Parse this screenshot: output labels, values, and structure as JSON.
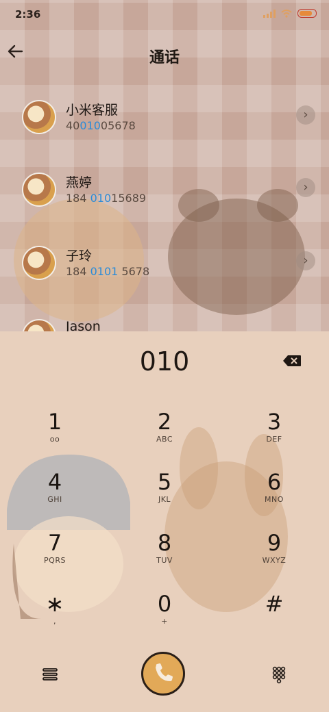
{
  "status": {
    "time": "2:36"
  },
  "header": {
    "title": "通话",
    "back_icon": "back-arrow-icon"
  },
  "contacts": [
    {
      "name": "小米客服",
      "number_pre": "40",
      "number_hl": "010",
      "number_post": "05678"
    },
    {
      "name": "燕婷",
      "number_pre": "184 ",
      "number_hl": "010",
      "number_post": "15689"
    },
    {
      "name": "子玲",
      "number_pre": "184 ",
      "number_hl": "0101",
      "number_post": " 5678"
    },
    {
      "name": "Jason",
      "number_pre": "",
      "number_hl": "",
      "number_post": ""
    }
  ],
  "dialer": {
    "display": "010",
    "keys": [
      {
        "digit": "1",
        "letters": "ᴏᴏ"
      },
      {
        "digit": "2",
        "letters": "ABC"
      },
      {
        "digit": "3",
        "letters": "DEF"
      },
      {
        "digit": "4",
        "letters": "GHI"
      },
      {
        "digit": "5",
        "letters": "JKL"
      },
      {
        "digit": "6",
        "letters": "MNO"
      },
      {
        "digit": "7",
        "letters": "PQRS"
      },
      {
        "digit": "8",
        "letters": "TUV"
      },
      {
        "digit": "9",
        "letters": "WXYZ"
      },
      {
        "digit": "∗",
        "letters": ","
      },
      {
        "digit": "0",
        "letters": "+"
      },
      {
        "digit": "#",
        "letters": ""
      }
    ]
  },
  "colors": {
    "accent": "#2a8bd8",
    "call": "#e2a958"
  }
}
